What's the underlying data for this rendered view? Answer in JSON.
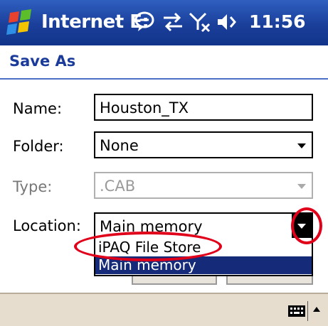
{
  "title_bar": {
    "app_name": "Internet E:",
    "time": "11:56"
  },
  "page": {
    "title": "Save As"
  },
  "form": {
    "name_label": "Name:",
    "name_value": "Houston_TX",
    "folder_label": "Folder:",
    "folder_value": "None",
    "type_label": "Type:",
    "type_value": ".CAB",
    "location_label": "Location:",
    "location_value": "Main memory"
  },
  "location_options": [
    {
      "label": "iPAQ File Store",
      "selected": false
    },
    {
      "label": "Main memory",
      "selected": true
    }
  ],
  "icons": {
    "start": "windows-flag-icon",
    "messaging": "speech-bubble-icon",
    "connectivity": "sync-arrows-icon",
    "signal": "no-signal-icon",
    "volume": "speaker-icon",
    "keyboard": "keyboard-icon"
  },
  "colors": {
    "title_bar": "#1a3f9a",
    "selection": "#152a78",
    "annotation": "#e0001a",
    "bottom_bar": "#e6ddcf"
  }
}
